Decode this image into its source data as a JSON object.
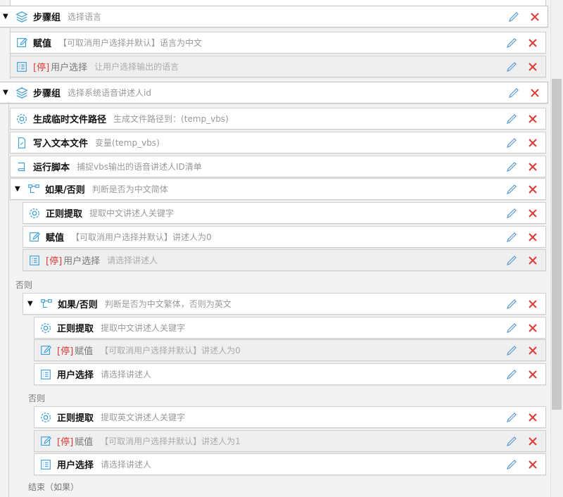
{
  "rows": [
    {
      "title": "步骤组",
      "desc": "选择语言"
    },
    {
      "title": "赋值",
      "desc": "【可取消用户选择并默认】语言为中文"
    },
    {
      "stop": "[停]",
      "title": "用户选择",
      "desc": "让用户选择输出的语言"
    },
    {
      "title": "步骤组",
      "desc": "选择系统语音讲述人id"
    },
    {
      "title": "生成临时文件路径",
      "desc": "生成文件路径到：(temp_vbs)"
    },
    {
      "title": "写入文本文件",
      "desc": "变量(temp_vbs)"
    },
    {
      "title": "运行脚本",
      "desc": "捕捉vbs输出的语音讲述人ID清单"
    },
    {
      "title": "如果/否则",
      "desc": "判断是否为中文简体"
    },
    {
      "title": "正则提取",
      "desc": "提取中文讲述人关键字"
    },
    {
      "title": "赋值",
      "desc": "【可取消用户选择并默认】讲述人为0"
    },
    {
      "stop": "[停]",
      "title": "用户选择",
      "desc": "请选择讲述人"
    },
    {
      "title": "如果/否则",
      "desc": "判断是否为中文繁体，否则为英文"
    },
    {
      "title": "正则提取",
      "desc": "提取中文讲述人关键字"
    },
    {
      "stop": "[停]",
      "title": "赋值",
      "desc": "【可取消用户选择并默认】讲述人为0"
    },
    {
      "title": "用户选择",
      "desc": "请选择讲述人"
    },
    {
      "title": "正则提取",
      "desc": "提取英文讲述人关键字"
    },
    {
      "stop": "[停]",
      "title": "赋值",
      "desc": "【可取消用户选择并默认】讲述人为1"
    },
    {
      "title": "用户选择",
      "desc": "请选择讲述人"
    }
  ],
  "labels": {
    "else1": "否则",
    "else2": "否则",
    "end_if": "结束（如果）"
  },
  "colors": {
    "edit_icon": "#5b9bd5",
    "delete_icon": "#e53935",
    "group_icon": "#2f9be0",
    "stop_text": "#e53935"
  }
}
